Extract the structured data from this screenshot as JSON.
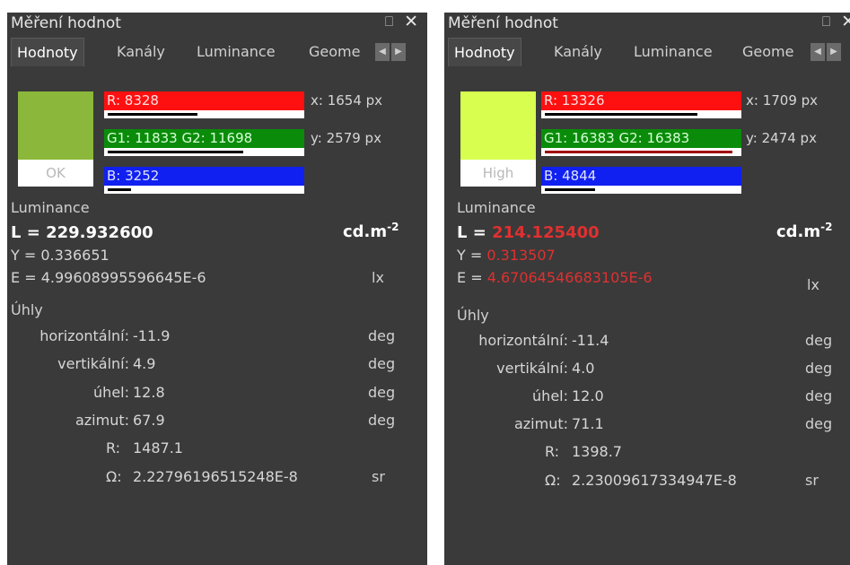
{
  "panels": [
    {
      "title": "Měření hodnot",
      "tabs": [
        "Hodnoty",
        "Kanály",
        "Luminance",
        "Geome"
      ],
      "swatch_color": "#8bb83a",
      "swatch_label": "OK",
      "channels": {
        "r": "R: 8328",
        "g": "G1: 11833 G2: 11698",
        "b": "B: 3252",
        "r_level": 0.465,
        "g_level": 0.7,
        "b_level": 0.12
      },
      "x": "x: 1654 px",
      "y": "y: 2579 px",
      "luminance_header": "Luminance",
      "L_label": "L = ",
      "L_value": "229.932600",
      "Y_label": "Y = ",
      "Y_value": "0.336651",
      "E_label": "E = ",
      "E_value": "4.99608995596645E-6",
      "lum_unit": "cd.m",
      "lum_unit_exp": "-2",
      "lx_unit": "lx",
      "angles_header": "Úhly",
      "h_label": "horizontální:",
      "h_value": "-11.9",
      "v_label": "vertikální:",
      "v_value": "4.9",
      "uhel_label": "úhel:",
      "uhel_value": "12.8",
      "az_label": "azimut:",
      "az_value": "67.9",
      "deg": "deg",
      "R_label": "R:",
      "R_value": "1487.1",
      "omega_label": "Ω:",
      "omega_value": "2.22796196515248E-8",
      "sr": "sr"
    },
    {
      "title": "Měření hodnot",
      "tabs": [
        "Hodnoty",
        "Kanály",
        "Luminance",
        "Geome"
      ],
      "swatch_color": "#d8ff50",
      "swatch_label": "High",
      "channels": {
        "r": "R: 13326",
        "g": "G1: 16383 G2: 16383",
        "b": "B: 4844",
        "r_level": 0.79,
        "g_level": 0.97,
        "b_level": 0.26
      },
      "x": "x: 1709 px",
      "y": "y: 2474 px",
      "luminance_header": "Luminance",
      "L_label": "L = ",
      "L_value": "214.125400",
      "Y_label": "Y = ",
      "Y_value": "0.313507",
      "E_label": "E = ",
      "E_value": "4.67064546683105E-6",
      "lum_unit": "cd.m",
      "lum_unit_exp": "-2",
      "lx_unit": "lx",
      "angles_header": "Úhly",
      "h_label": "horizontální:",
      "h_value": "-11.4",
      "v_label": "vertikální:",
      "v_value": "4.0",
      "uhel_label": "úhel:",
      "uhel_value": "12.0",
      "az_label": "azimut:",
      "az_value": "71.1",
      "deg": "deg",
      "R_label": "R:",
      "R_value": "1398.7",
      "omega_label": "Ω:",
      "omega_value": "2.23009617334947E-8",
      "sr": "sr"
    }
  ],
  "colors": {
    "panel_bg": "#3a3a3a",
    "red_channel": "#ff1010",
    "green_channel": "#0a8c0a",
    "blue_channel": "#1020f0",
    "warning_text": "#e03030"
  },
  "icons": [
    "pin-icon",
    "close-icon",
    "tab-scroll-left-icon",
    "tab-scroll-right-icon"
  ]
}
